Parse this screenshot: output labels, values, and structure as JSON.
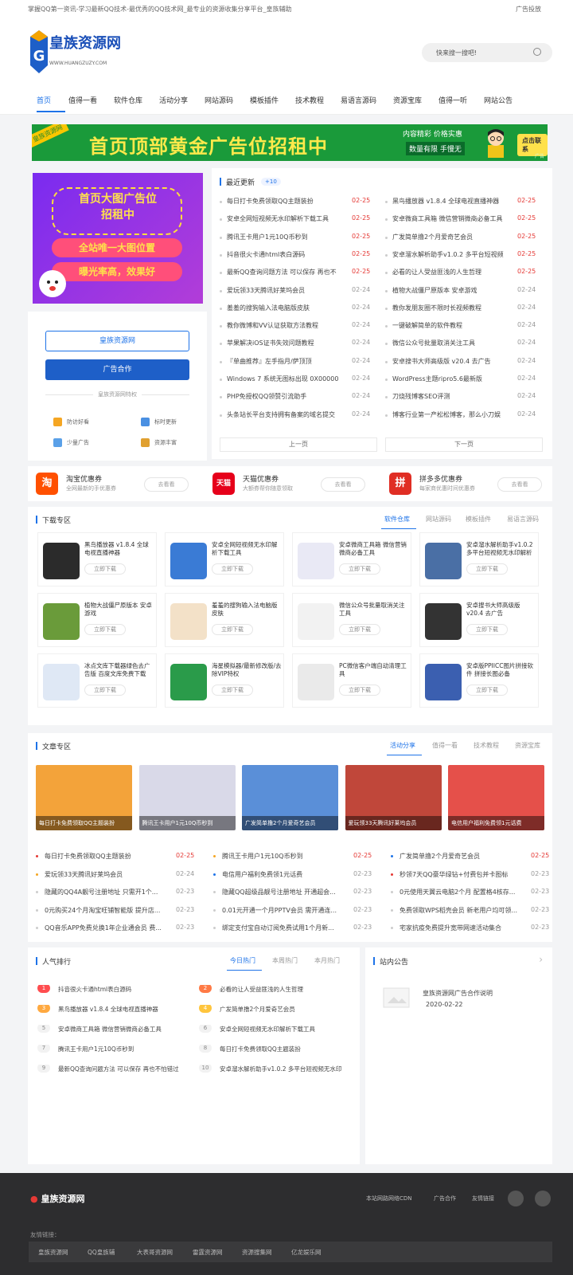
{
  "topbar": {
    "tagline": "掌握QQ第一资讯-学习最新QQ技术-最优秀的QQ技术网_最专业的资源收集分享平台_皇族辅助",
    "ad_link": "广告投放"
  },
  "logo": {
    "name": "皇族资源网",
    "url": "WWW.HUANGZUZY.COM"
  },
  "search": {
    "placeholder": "快来搜一搜吧!"
  },
  "nav": [
    "首页",
    "值得一看",
    "软件仓库",
    "活动分享",
    "网站源码",
    "模板插件",
    "技术教程",
    "易语言源码",
    "资源宝库",
    "值得一听",
    "网站公告"
  ],
  "banner": {
    "corner": "皇族资源网",
    "title": "首页顶部黄金广告位招租中",
    "line1": "内容精彩 价格实惠",
    "line2": "数量有限 手慢无",
    "button": "点击联系",
    "ad": "广告"
  },
  "bigad": {
    "line1": "首页大图广告位",
    "line2": "招租中",
    "pill1": "全站唯一大图位置",
    "pill2": "曝光率高，效果好"
  },
  "sidebar": {
    "btn1": "皇族资源网",
    "btn2": "广告合作",
    "feat_title": "皇族资源网特权",
    "feats": [
      {
        "label": "防访好看"
      },
      {
        "label": "标时更新"
      },
      {
        "label": "少量广告"
      },
      {
        "label": "资源丰富"
      }
    ]
  },
  "latest": {
    "title": "最近更新",
    "count": "+10",
    "prev": "上一页",
    "next": "下一页",
    "left": [
      {
        "t": "每日打卡免费领取QQ主题装扮",
        "d": "02-25"
      },
      {
        "t": "安卓全网短视频无水印解析下载工具",
        "d": "02-25"
      },
      {
        "t": "腾讯王卡用户1元10Q币秒到",
        "d": "02-25"
      },
      {
        "t": "抖音很火卡通html表白源码",
        "d": "02-25"
      },
      {
        "t": "最新QQ查询问题方法 可以保存 再也不",
        "d": "02-25"
      },
      {
        "t": "爱玩领33天腾讯好莱坞会员",
        "d": "02-24"
      },
      {
        "t": "羞羞的搜狗输入法电脑版皮肤",
        "d": "02-24"
      },
      {
        "t": "教你微博和VV认证获取方法教程",
        "d": "02-24"
      },
      {
        "t": "苹果解决iOS证书失效问题教程",
        "d": "02-24"
      },
      {
        "t": "『单曲推荐』左手指月/萨顶顶",
        "d": "02-24"
      },
      {
        "t": "Windows 7 系统无图标出现 0X000000",
        "d": "02-24"
      },
      {
        "t": "PHP免授权QQ领赞引流助手",
        "d": "02-24"
      },
      {
        "t": "头条站长平台支持拥有备案的域名提交",
        "d": "02-24"
      }
    ],
    "right": [
      {
        "t": "黑鸟播放器 v1.8.4 全球电视直播神器",
        "d": "02-25"
      },
      {
        "t": "安卓微商工具箱 微信营销微商必备工具",
        "d": "02-25"
      },
      {
        "t": "广发简单撸2个月爱奇艺会员",
        "d": "02-25"
      },
      {
        "t": "安卓溜水解析助手v1.0.2 多平台短视频",
        "d": "02-25"
      },
      {
        "t": "必看的让人受益匪浅的人生哲理",
        "d": "02-25"
      },
      {
        "t": "植物大战僵尸原版本 安卓游戏",
        "d": "02-24"
      },
      {
        "t": "教你发朋友圈不限时长视频教程",
        "d": "02-24"
      },
      {
        "t": "一键破解简单的软件教程",
        "d": "02-24"
      },
      {
        "t": "微信公众号批量取消关注工具",
        "d": "02-24"
      },
      {
        "t": "安卓搜书大师高级版 v20.4 去广告",
        "d": "02-24"
      },
      {
        "t": "WordPress主题ripro5.6最新版",
        "d": "02-24"
      },
      {
        "t": "刀烧残博客SEO评测",
        "d": "02-24"
      },
      {
        "t": "博客行业第一产松松博客，那么小刀娱",
        "d": "02-24"
      }
    ]
  },
  "coupons": [
    {
      "icon": "淘",
      "title": "淘宝优惠券",
      "sub": "全网最新的手优惠券",
      "go": "去看看",
      "color": "#ff5000"
    },
    {
      "icon": "天猫",
      "title": "天猫优惠券",
      "sub": "大额券帮你随意领取",
      "go": "去看看",
      "color": "#e6001a"
    },
    {
      "icon": "拼",
      "title": "拼多多优惠券",
      "sub": "每家商优惠时间优惠券",
      "go": "去看看",
      "color": "#e02e24"
    }
  ],
  "download": {
    "title": "下载专区",
    "tabs": [
      "软件仓库",
      "网站源码",
      "模板插件",
      "易语言源码"
    ],
    "button": "立即下载",
    "items": [
      "黑鸟播放器 v1.8.4 全球电视直播神器",
      "安卓全网短视频无水印解析下载工具",
      "安卓微商工具箱 微信营销微商必备工具",
      "安卓溜水解析助手v1.0.2 多平台短视频无水印解析",
      "植物大战僵尸原版本 安卓游戏",
      "羞羞的搜狗输入法电脑版皮肤",
      "微信公众号批量取消关注工具",
      "安卓搜书大师高级版 v20.4 去广告",
      "冰点文库下载器绿色去广告版 百度文库免费下载",
      "海星模拟器/最新修改版/去除VIP特权",
      "PC微信客户端自动清理工具",
      "安卓版PPIICC图片拼接软件 拼接长图必备"
    ]
  },
  "articles": {
    "title": "文章专区",
    "tabs": [
      "活动分享",
      "值得一看",
      "技术教程",
      "资源宝库"
    ],
    "pics": [
      "每日打卡免费领取QQ主题装扮",
      "腾讯王卡用户1元10Q币秒到",
      "广发简单撸2个月爱奇艺会员",
      "爱玩领33天腾讯好莱坞会员",
      "电信用户福利免费领1元话费"
    ],
    "cols": [
      [
        {
          "t": "每日打卡免费领取QQ主题装扮",
          "d": "02-25"
        },
        {
          "t": "爱玩领33天腾讯好莱坞会员",
          "d": "02-24"
        },
        {
          "t": "隐藏的QQ4A靓号注册地址 只需开1个...",
          "d": "02-23"
        },
        {
          "t": "0元购买24个月淘宝旺铺智能版 提升店...",
          "d": "02-23"
        },
        {
          "t": "QQ音乐APP免费兑换1年企业通会员 费...",
          "d": "02-23"
        }
      ],
      [
        {
          "t": "腾讯王卡用户1元10Q币秒到",
          "d": "02-25"
        },
        {
          "t": "电信用户福利免费领1元话费",
          "d": "02-23"
        },
        {
          "t": "隐藏QQ超级品靓号注册地址 开通超会...",
          "d": "02-23"
        },
        {
          "t": "0.01元开通一个月PPTV会员 需开通连...",
          "d": "02-23"
        },
        {
          "t": "绑定支付宝自动订阅免费试用1个月新...",
          "d": "02-23"
        }
      ],
      [
        {
          "t": "广发简单撸2个月爱奇艺会员",
          "d": "02-25"
        },
        {
          "t": "秒领7天QQ豪华绿钻+付费包并卡图标",
          "d": "02-23"
        },
        {
          "t": "0元使用天翼云电脑2个月 配置格4核存...",
          "d": "02-23"
        },
        {
          "t": "免费领取WPS稻壳会员 新老用户均可领...",
          "d": "02-23"
        },
        {
          "t": "宅家抗疫免费提升宽带网速活动集合",
          "d": "02-23"
        }
      ]
    ]
  },
  "ranking": {
    "title": "人气排行",
    "tabs": [
      "今日热门",
      "本周热门",
      "本月热门"
    ],
    "items": [
      {
        "n": "1",
        "t": "抖音很火卡通html表白源码"
      },
      {
        "n": "2",
        "t": "必看的让人受益匪浅的人生哲理"
      },
      {
        "n": "3",
        "t": "黑鸟播放器 v1.8.4 全球电视直播神器"
      },
      {
        "n": "4",
        "t": "广发简单撸2个月爱奇艺会员"
      },
      {
        "n": "5",
        "t": "安卓微商工具箱 微信营销微商必备工具"
      },
      {
        "n": "6",
        "t": "安卓全网短视频无水印解析下载工具"
      },
      {
        "n": "7",
        "t": "腾讯王卡用户1元10Q币秒到"
      },
      {
        "n": "8",
        "t": "每日打卡免费领取QQ主题装扮"
      },
      {
        "n": "9",
        "t": "最新QQ查询问题方法 可以保存 再也不怕错过"
      },
      {
        "n": "10",
        "t": "安卓溜水解析助手v1.0.2 多平台短视频无水印"
      }
    ]
  },
  "notice": {
    "title": "站内公告",
    "item": "皇族资源网广告合作说明",
    "date": "2020-02-22"
  },
  "footer": {
    "logo": "皇族资源网",
    "links": [
      "本站网路网络CDN",
      "广告合作",
      "友情链接"
    ],
    "friend_label": "友情链接：",
    "friends": [
      "皇族资源网",
      "QQ皇族辅",
      "大表哥资源网",
      "雷霆资源网",
      "资源搜集网",
      "亿龙娱乐网"
    ]
  }
}
